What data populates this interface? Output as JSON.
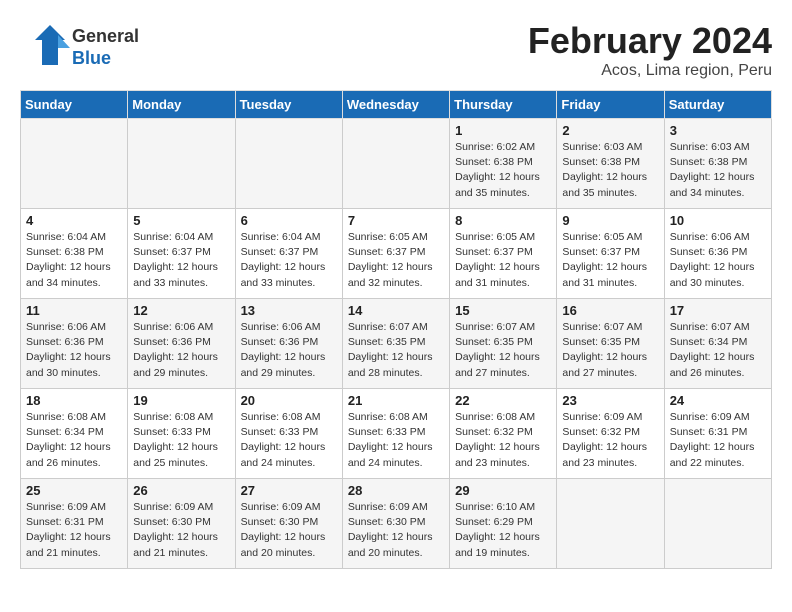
{
  "logo": {
    "line1": "General",
    "line2": "Blue"
  },
  "title": "February 2024",
  "subtitle": "Acos, Lima region, Peru",
  "days_of_week": [
    "Sunday",
    "Monday",
    "Tuesday",
    "Wednesday",
    "Thursday",
    "Friday",
    "Saturday"
  ],
  "weeks": [
    [
      {
        "day": "",
        "sunrise": "",
        "sunset": "",
        "daylight": ""
      },
      {
        "day": "",
        "sunrise": "",
        "sunset": "",
        "daylight": ""
      },
      {
        "day": "",
        "sunrise": "",
        "sunset": "",
        "daylight": ""
      },
      {
        "day": "",
        "sunrise": "",
        "sunset": "",
        "daylight": ""
      },
      {
        "day": "1",
        "sunrise": "Sunrise: 6:02 AM",
        "sunset": "Sunset: 6:38 PM",
        "daylight": "Daylight: 12 hours and 35 minutes."
      },
      {
        "day": "2",
        "sunrise": "Sunrise: 6:03 AM",
        "sunset": "Sunset: 6:38 PM",
        "daylight": "Daylight: 12 hours and 35 minutes."
      },
      {
        "day": "3",
        "sunrise": "Sunrise: 6:03 AM",
        "sunset": "Sunset: 6:38 PM",
        "daylight": "Daylight: 12 hours and 34 minutes."
      }
    ],
    [
      {
        "day": "4",
        "sunrise": "Sunrise: 6:04 AM",
        "sunset": "Sunset: 6:38 PM",
        "daylight": "Daylight: 12 hours and 34 minutes."
      },
      {
        "day": "5",
        "sunrise": "Sunrise: 6:04 AM",
        "sunset": "Sunset: 6:37 PM",
        "daylight": "Daylight: 12 hours and 33 minutes."
      },
      {
        "day": "6",
        "sunrise": "Sunrise: 6:04 AM",
        "sunset": "Sunset: 6:37 PM",
        "daylight": "Daylight: 12 hours and 33 minutes."
      },
      {
        "day": "7",
        "sunrise": "Sunrise: 6:05 AM",
        "sunset": "Sunset: 6:37 PM",
        "daylight": "Daylight: 12 hours and 32 minutes."
      },
      {
        "day": "8",
        "sunrise": "Sunrise: 6:05 AM",
        "sunset": "Sunset: 6:37 PM",
        "daylight": "Daylight: 12 hours and 31 minutes."
      },
      {
        "day": "9",
        "sunrise": "Sunrise: 6:05 AM",
        "sunset": "Sunset: 6:37 PM",
        "daylight": "Daylight: 12 hours and 31 minutes."
      },
      {
        "day": "10",
        "sunrise": "Sunrise: 6:06 AM",
        "sunset": "Sunset: 6:36 PM",
        "daylight": "Daylight: 12 hours and 30 minutes."
      }
    ],
    [
      {
        "day": "11",
        "sunrise": "Sunrise: 6:06 AM",
        "sunset": "Sunset: 6:36 PM",
        "daylight": "Daylight: 12 hours and 30 minutes."
      },
      {
        "day": "12",
        "sunrise": "Sunrise: 6:06 AM",
        "sunset": "Sunset: 6:36 PM",
        "daylight": "Daylight: 12 hours and 29 minutes."
      },
      {
        "day": "13",
        "sunrise": "Sunrise: 6:06 AM",
        "sunset": "Sunset: 6:36 PM",
        "daylight": "Daylight: 12 hours and 29 minutes."
      },
      {
        "day": "14",
        "sunrise": "Sunrise: 6:07 AM",
        "sunset": "Sunset: 6:35 PM",
        "daylight": "Daylight: 12 hours and 28 minutes."
      },
      {
        "day": "15",
        "sunrise": "Sunrise: 6:07 AM",
        "sunset": "Sunset: 6:35 PM",
        "daylight": "Daylight: 12 hours and 27 minutes."
      },
      {
        "day": "16",
        "sunrise": "Sunrise: 6:07 AM",
        "sunset": "Sunset: 6:35 PM",
        "daylight": "Daylight: 12 hours and 27 minutes."
      },
      {
        "day": "17",
        "sunrise": "Sunrise: 6:07 AM",
        "sunset": "Sunset: 6:34 PM",
        "daylight": "Daylight: 12 hours and 26 minutes."
      }
    ],
    [
      {
        "day": "18",
        "sunrise": "Sunrise: 6:08 AM",
        "sunset": "Sunset: 6:34 PM",
        "daylight": "Daylight: 12 hours and 26 minutes."
      },
      {
        "day": "19",
        "sunrise": "Sunrise: 6:08 AM",
        "sunset": "Sunset: 6:33 PM",
        "daylight": "Daylight: 12 hours and 25 minutes."
      },
      {
        "day": "20",
        "sunrise": "Sunrise: 6:08 AM",
        "sunset": "Sunset: 6:33 PM",
        "daylight": "Daylight: 12 hours and 24 minutes."
      },
      {
        "day": "21",
        "sunrise": "Sunrise: 6:08 AM",
        "sunset": "Sunset: 6:33 PM",
        "daylight": "Daylight: 12 hours and 24 minutes."
      },
      {
        "day": "22",
        "sunrise": "Sunrise: 6:08 AM",
        "sunset": "Sunset: 6:32 PM",
        "daylight": "Daylight: 12 hours and 23 minutes."
      },
      {
        "day": "23",
        "sunrise": "Sunrise: 6:09 AM",
        "sunset": "Sunset: 6:32 PM",
        "daylight": "Daylight: 12 hours and 23 minutes."
      },
      {
        "day": "24",
        "sunrise": "Sunrise: 6:09 AM",
        "sunset": "Sunset: 6:31 PM",
        "daylight": "Daylight: 12 hours and 22 minutes."
      }
    ],
    [
      {
        "day": "25",
        "sunrise": "Sunrise: 6:09 AM",
        "sunset": "Sunset: 6:31 PM",
        "daylight": "Daylight: 12 hours and 21 minutes."
      },
      {
        "day": "26",
        "sunrise": "Sunrise: 6:09 AM",
        "sunset": "Sunset: 6:30 PM",
        "daylight": "Daylight: 12 hours and 21 minutes."
      },
      {
        "day": "27",
        "sunrise": "Sunrise: 6:09 AM",
        "sunset": "Sunset: 6:30 PM",
        "daylight": "Daylight: 12 hours and 20 minutes."
      },
      {
        "day": "28",
        "sunrise": "Sunrise: 6:09 AM",
        "sunset": "Sunset: 6:30 PM",
        "daylight": "Daylight: 12 hours and 20 minutes."
      },
      {
        "day": "29",
        "sunrise": "Sunrise: 6:10 AM",
        "sunset": "Sunset: 6:29 PM",
        "daylight": "Daylight: 12 hours and 19 minutes."
      },
      {
        "day": "",
        "sunrise": "",
        "sunset": "",
        "daylight": ""
      },
      {
        "day": "",
        "sunrise": "",
        "sunset": "",
        "daylight": ""
      }
    ]
  ]
}
